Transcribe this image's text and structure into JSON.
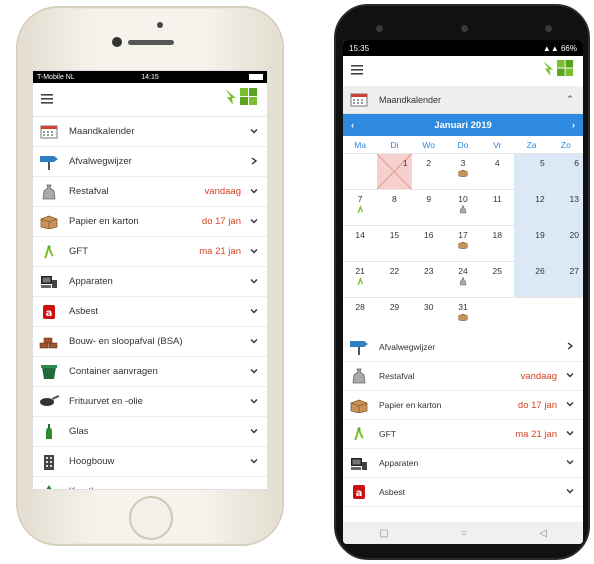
{
  "phone1": {
    "status": {
      "carrier": "T-Mobile NL",
      "time": "14:15"
    },
    "items": [
      {
        "icon": "calendar-icon",
        "label": "Maandkalender",
        "date": "",
        "chevron": "down"
      },
      {
        "icon": "signpost-icon",
        "label": "Afvalwegwijzer",
        "date": "",
        "chevron": "right"
      },
      {
        "icon": "trash-bag-icon",
        "label": "Restafval",
        "date": "vandaag",
        "chevron": "down"
      },
      {
        "icon": "cardboard-box-icon",
        "label": "Papier en karton",
        "date": "do 17 jan",
        "chevron": "down"
      },
      {
        "icon": "apple-core-icon",
        "label": "GFT",
        "date": "ma 21 jan",
        "chevron": "down"
      },
      {
        "icon": "appliances-icon",
        "label": "Apparaten",
        "date": "",
        "chevron": "down"
      },
      {
        "icon": "asbestos-icon",
        "label": "Asbest",
        "date": "",
        "chevron": "down"
      },
      {
        "icon": "bricks-icon",
        "label": "Bouw- en sloopafval (BSA)",
        "date": "",
        "chevron": "down"
      },
      {
        "icon": "container-icon",
        "label": "Container aanvragen",
        "date": "",
        "chevron": "down"
      },
      {
        "icon": "frying-pan-icon",
        "label": "Frituurvet en -olie",
        "date": "",
        "chevron": "down"
      },
      {
        "icon": "bottle-icon",
        "label": "Glas",
        "date": "",
        "chevron": "down"
      },
      {
        "icon": "building-icon",
        "label": "Hoogbouw",
        "date": "",
        "chevron": "down"
      },
      {
        "icon": "tree-icon",
        "label": "Kerstbomen",
        "date": "",
        "chevron": "down"
      }
    ]
  },
  "phone2": {
    "status": {
      "time": "15:35",
      "battery": "66%"
    },
    "section_title": "Maandkalender",
    "calendar": {
      "month": "Januari 2019",
      "weekdays": [
        "Ma",
        "Di",
        "Wo",
        "Do",
        "Vr",
        "Za",
        "Zo"
      ],
      "weeks": [
        [
          {
            "d": ""
          },
          {
            "d": "1",
            "today": true
          },
          {
            "d": "2"
          },
          {
            "d": "3",
            "icon": "box"
          },
          {
            "d": "4"
          },
          {
            "d": "5",
            "we": true
          },
          {
            "d": "6",
            "we": true
          }
        ],
        [
          {
            "d": "7",
            "icon": "gft"
          },
          {
            "d": "8"
          },
          {
            "d": "9"
          },
          {
            "d": "10",
            "icon": "bag"
          },
          {
            "d": "11"
          },
          {
            "d": "12",
            "we": true
          },
          {
            "d": "13",
            "we": true
          }
        ],
        [
          {
            "d": "14"
          },
          {
            "d": "15"
          },
          {
            "d": "16"
          },
          {
            "d": "17",
            "icon": "box"
          },
          {
            "d": "18"
          },
          {
            "d": "19",
            "we": true
          },
          {
            "d": "20",
            "we": true
          }
        ],
        [
          {
            "d": "21",
            "icon": "gft"
          },
          {
            "d": "22"
          },
          {
            "d": "23"
          },
          {
            "d": "24",
            "icon": "bag"
          },
          {
            "d": "25"
          },
          {
            "d": "26",
            "we": true
          },
          {
            "d": "27",
            "we": true
          }
        ],
        [
          {
            "d": "28"
          },
          {
            "d": "29"
          },
          {
            "d": "30"
          },
          {
            "d": "31",
            "icon": "box"
          },
          {
            "d": ""
          },
          {
            "d": ""
          },
          {
            "d": ""
          }
        ]
      ]
    },
    "items": [
      {
        "icon": "signpost-icon",
        "label": "Afvalwegwijzer",
        "date": "",
        "chevron": "right"
      },
      {
        "icon": "trash-bag-icon",
        "label": "Restafval",
        "date": "vandaag",
        "chevron": "down"
      },
      {
        "icon": "cardboard-box-icon",
        "label": "Papier en karton",
        "date": "do 17 jan",
        "chevron": "down"
      },
      {
        "icon": "apple-core-icon",
        "label": "GFT",
        "date": "ma 21 jan",
        "chevron": "down"
      },
      {
        "icon": "appliances-icon",
        "label": "Apparaten",
        "date": "",
        "chevron": "down"
      },
      {
        "icon": "asbestos-icon",
        "label": "Asbest",
        "date": "",
        "chevron": "down"
      }
    ]
  },
  "colors": {
    "accent": "#2d8ae0",
    "date_red": "#d9411e",
    "logo_green": "#7cbf2e",
    "weekend": "#dbe9f7"
  }
}
